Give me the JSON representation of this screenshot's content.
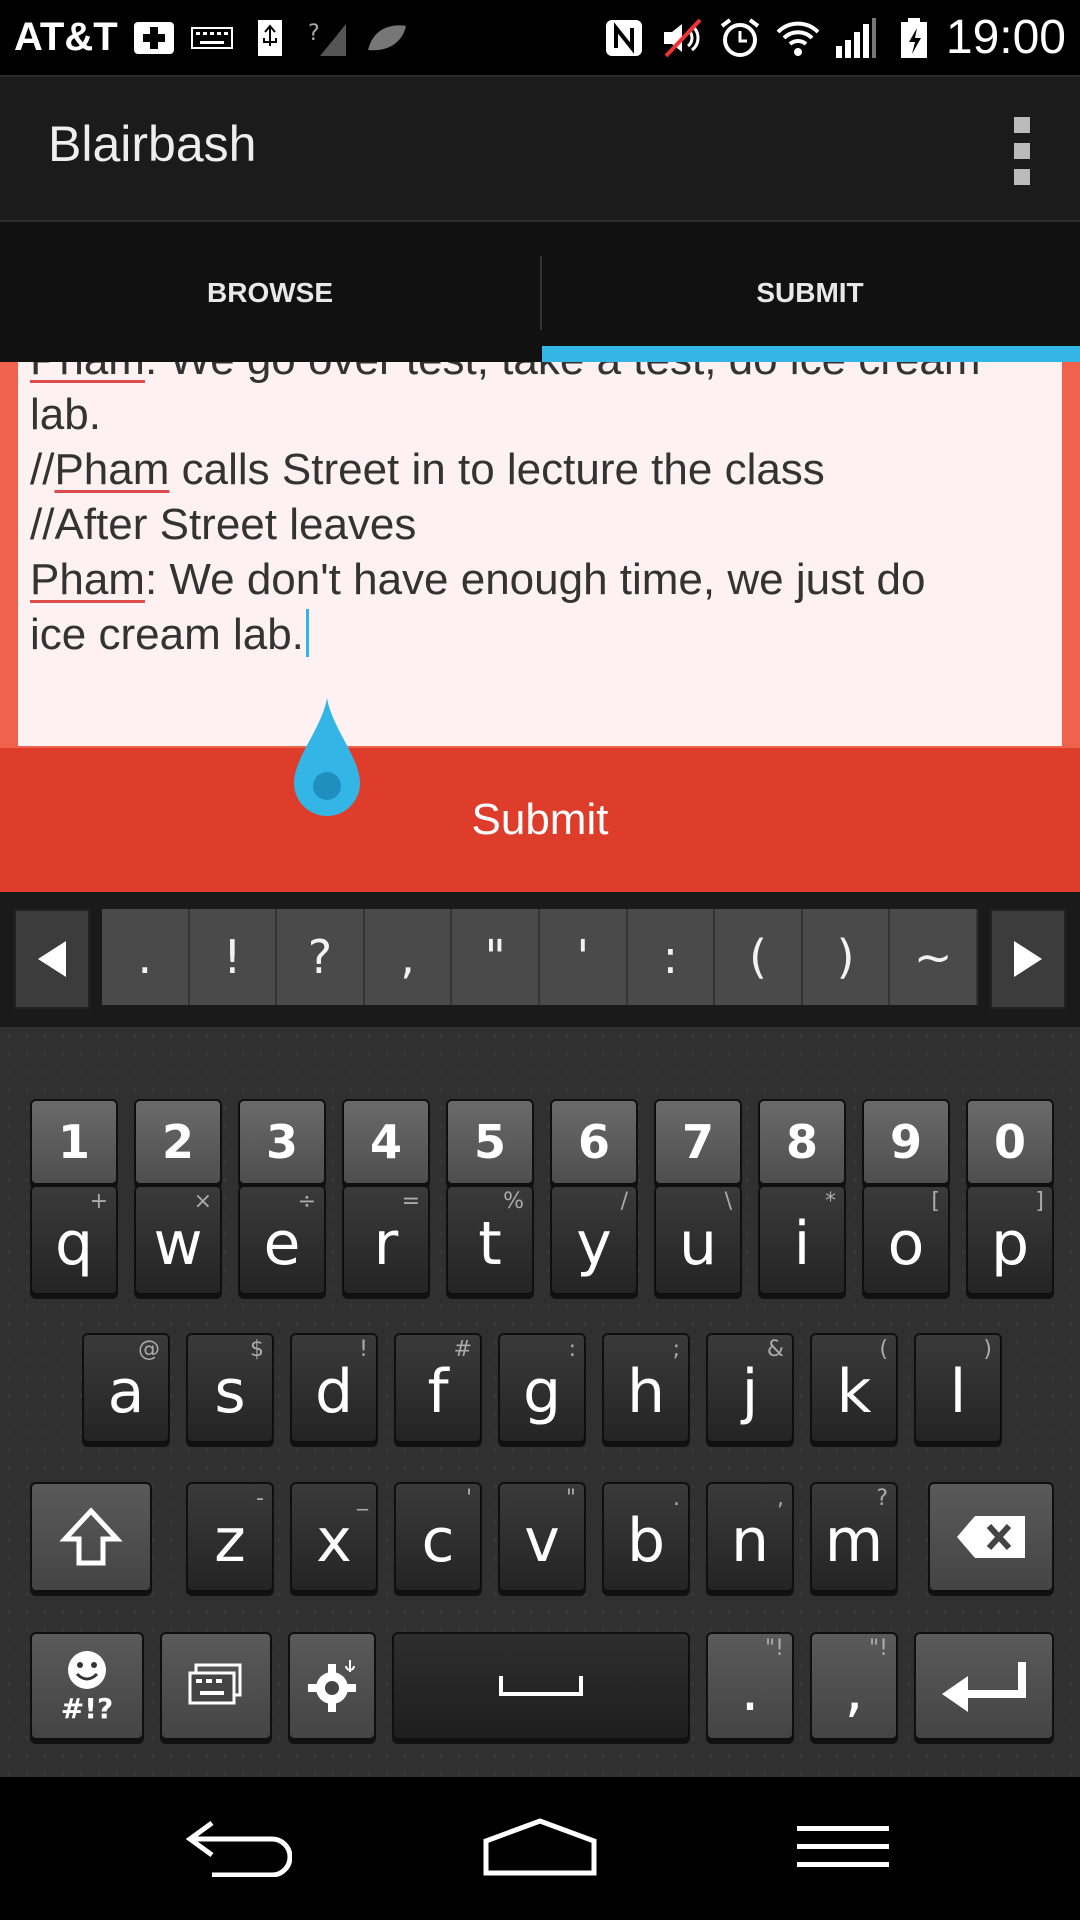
{
  "status_bar": {
    "carrier": "AT&T",
    "time": "19:00",
    "icons": [
      "medical-plus-icon",
      "keyboard-icon",
      "usb-icon",
      "no-signal-icon",
      "leaf-icon",
      "nfc-icon",
      "mute-icon",
      "alarm-icon",
      "wifi-icon",
      "signal-icon",
      "battery-charging-icon"
    ]
  },
  "app": {
    "title": "Blairbash"
  },
  "tabs": [
    {
      "label": "BROWSE",
      "selected": false
    },
    {
      "label": "SUBMIT",
      "selected": true
    }
  ],
  "editor": {
    "lines": [
      [
        {
          "t": "Pham",
          "err": true
        },
        {
          "t": ": We go over test, take a test, do ice cream"
        }
      ],
      [
        {
          "t": "lab."
        }
      ],
      [
        {
          "t": "//"
        },
        {
          "t": "Pham",
          "err": true
        },
        {
          "t": " calls Street in to lecture the class"
        }
      ],
      [
        {
          "t": "//After Street leaves"
        }
      ],
      [
        {
          "t": "Pham",
          "err": true
        },
        {
          "t": ": We don't have enough time, we just do"
        }
      ],
      [
        {
          "t": "ice cream lab."
        }
      ]
    ]
  },
  "submit": {
    "label": "Submit"
  },
  "keyboard": {
    "punctuation": [
      ".",
      "!",
      "?",
      ",",
      "\"",
      "'",
      ":",
      "(",
      ")",
      "~"
    ],
    "numbers": [
      "1",
      "2",
      "3",
      "4",
      "5",
      "6",
      "7",
      "8",
      "9",
      "0"
    ],
    "row1": [
      {
        "k": "q",
        "a": "+"
      },
      {
        "k": "w",
        "a": "×"
      },
      {
        "k": "e",
        "a": "÷"
      },
      {
        "k": "r",
        "a": "="
      },
      {
        "k": "t",
        "a": "%"
      },
      {
        "k": "y",
        "a": "/"
      },
      {
        "k": "u",
        "a": "\\"
      },
      {
        "k": "i",
        "a": "*"
      },
      {
        "k": "o",
        "a": "["
      },
      {
        "k": "p",
        "a": "]"
      }
    ],
    "row2": [
      {
        "k": "a",
        "a": "@"
      },
      {
        "k": "s",
        "a": "$"
      },
      {
        "k": "d",
        "a": "!"
      },
      {
        "k": "f",
        "a": "#"
      },
      {
        "k": "g",
        "a": ":"
      },
      {
        "k": "h",
        "a": ";"
      },
      {
        "k": "j",
        "a": "&"
      },
      {
        "k": "k",
        "a": "("
      },
      {
        "k": "l",
        "a": ")"
      }
    ],
    "row3": [
      {
        "k": "z",
        "a": "-"
      },
      {
        "k": "x",
        "a": "_"
      },
      {
        "k": "c",
        "a": "'"
      },
      {
        "k": "v",
        "a": "\""
      },
      {
        "k": "b",
        "a": "."
      },
      {
        "k": "n",
        "a": ","
      },
      {
        "k": "m",
        "a": "?"
      }
    ],
    "emoji_key": "#!?",
    "period_key": ".",
    "comma_key": ","
  },
  "colors": {
    "accent": "#33b5e5",
    "submit_bg": "#df3d2b",
    "editor_bg": "#fdf2f1"
  }
}
